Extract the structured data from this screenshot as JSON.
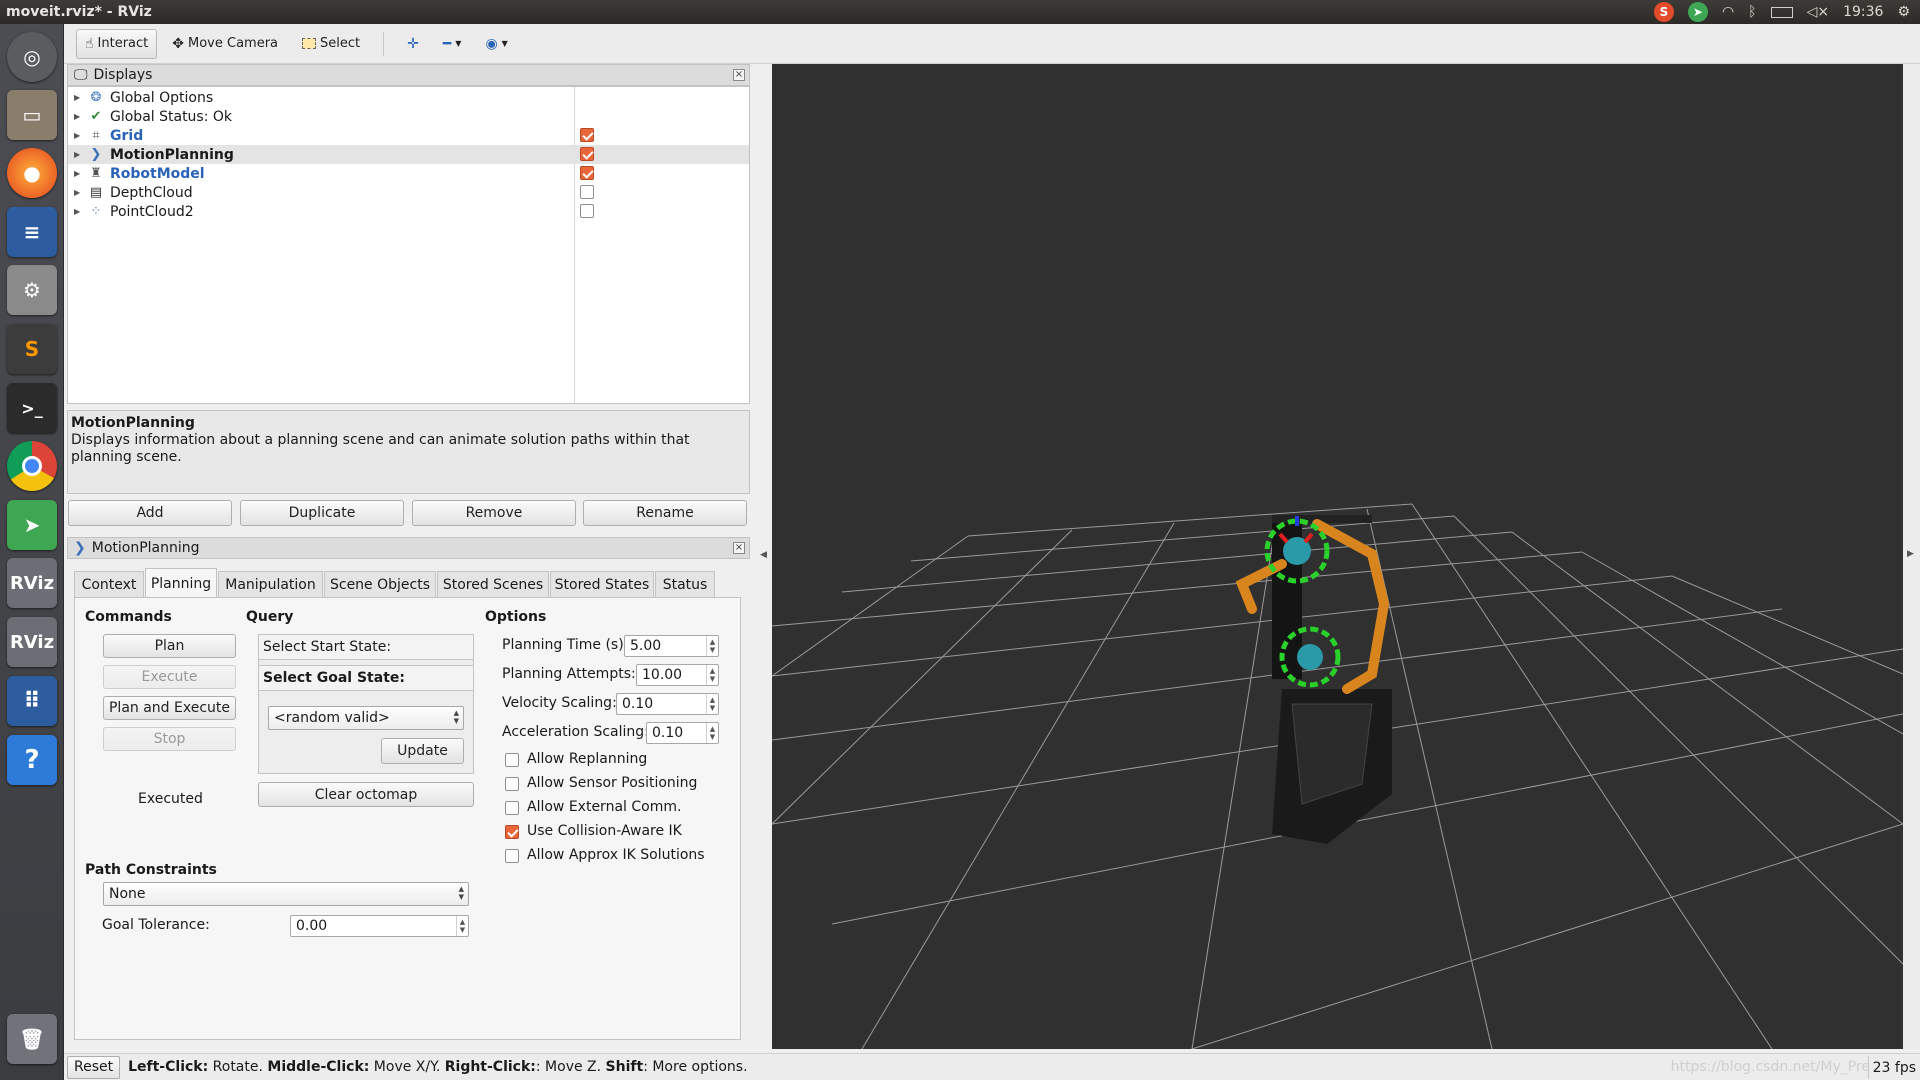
{
  "window": {
    "title": "moveit.rviz* - RViz",
    "clock": "19:36"
  },
  "toolbar": {
    "interact": "Interact",
    "move_camera": "Move Camera",
    "select": "Select"
  },
  "displays_panel": {
    "title": "Displays",
    "items": [
      {
        "label": "Global Options",
        "icon": "globe-icon"
      },
      {
        "label": "Global Status: Ok",
        "icon": "check-icon"
      },
      {
        "label": "Grid",
        "icon": "grid-icon",
        "checked": true
      },
      {
        "label": "MotionPlanning",
        "icon": "motion-icon",
        "checked": true
      },
      {
        "label": "RobotModel",
        "icon": "robot-icon",
        "checked": true
      },
      {
        "label": "DepthCloud",
        "icon": "depth-icon",
        "checked": false
      },
      {
        "label": "PointCloud2",
        "icon": "points-icon",
        "checked": false
      }
    ]
  },
  "description": {
    "title": "MotionPlanning",
    "text": "Displays information about a planning scene and can animate solution paths within that planning scene."
  },
  "display_buttons": {
    "add": "Add",
    "duplicate": "Duplicate",
    "remove": "Remove",
    "rename": "Rename"
  },
  "motion_panel": {
    "title": "MotionPlanning",
    "tabs": [
      "Context",
      "Planning",
      "Manipulation",
      "Scene Objects",
      "Stored Scenes",
      "Stored States",
      "Status"
    ],
    "commands": {
      "heading": "Commands",
      "plan": "Plan",
      "execute": "Execute",
      "plan_execute": "Plan and Execute",
      "stop": "Stop",
      "status": "Executed"
    },
    "query": {
      "heading": "Query",
      "start": "Select Start State:",
      "goal": "Select Goal State:",
      "goal_value": "<random valid>",
      "update": "Update",
      "clear_octomap": "Clear octomap"
    },
    "options": {
      "heading": "Options",
      "planning_time_label": "Planning Time (s):",
      "planning_time": "5.00",
      "planning_attempts_label": "Planning Attempts:",
      "planning_attempts": "10.00",
      "velocity_label": "Velocity Scaling:",
      "velocity": "0.10",
      "accel_label": "Acceleration Scaling:",
      "accel": "0.10",
      "checks": [
        {
          "label": "Allow Replanning",
          "checked": false
        },
        {
          "label": "Allow Sensor Positioning",
          "checked": false
        },
        {
          "label": "Allow External Comm.",
          "checked": false
        },
        {
          "label": "Use Collision-Aware IK",
          "checked": true
        },
        {
          "label": "Allow Approx IK Solutions",
          "checked": false
        }
      ]
    },
    "path": {
      "heading": "Path Constraints",
      "value": "None",
      "tolerance_label": "Goal Tolerance:",
      "tolerance": "0.00"
    }
  },
  "statusbar": {
    "reset": "Reset",
    "lc": "Left-Click:",
    "lc_t": " Rotate. ",
    "mc": "Middle-Click:",
    "mc_t": " Move X/Y. ",
    "rc": "Right-Click:",
    "rc_t": ": Move Z. ",
    "sh": "Shift",
    "sh_t": ": More options.",
    "fps": "23 fps",
    "watermark": "https://blog.csdn.net/My_Pre"
  }
}
